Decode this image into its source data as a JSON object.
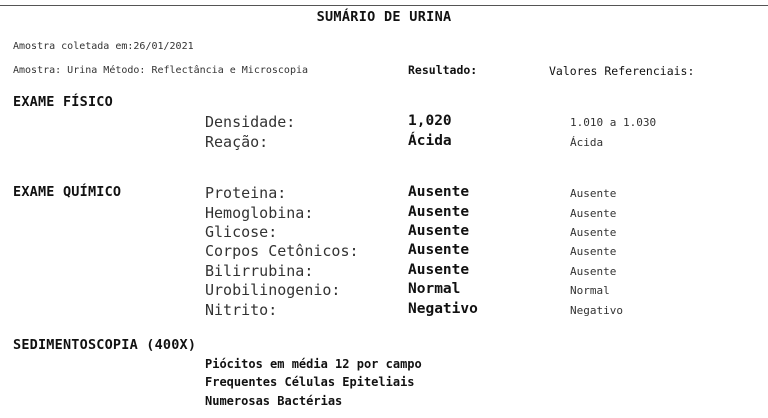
{
  "title": "SUMÁRIO DE URINA",
  "collected": "Amostra coletada em:26/01/2021",
  "sample_method": "Amostra: Urina  Método: Reflectância e Microscopia",
  "result_header": "Resultado:",
  "reference_header": "Valores Referenciais:",
  "physical": {
    "heading": "EXAME FÍSICO",
    "rows": [
      {
        "label": "Densidade:",
        "result": "1,020",
        "reference": "1.010 a 1.030"
      },
      {
        "label": "Reação:",
        "result": "Ácida",
        "reference": "Ácida"
      }
    ]
  },
  "chemical": {
    "heading": "EXAME QUÍMICO",
    "rows": [
      {
        "label": "Proteina:",
        "result": "Ausente",
        "reference": "Ausente"
      },
      {
        "label": "Hemoglobina:",
        "result": "Ausente",
        "reference": "Ausente"
      },
      {
        "label": "Glicose:",
        "result": "Ausente",
        "reference": "Ausente"
      },
      {
        "label": "Corpos Cetônicos:",
        "result": "Ausente",
        "reference": "Ausente"
      },
      {
        "label": "Bilirrubina:",
        "result": "Ausente",
        "reference": "Ausente"
      },
      {
        "label": "Urobilinogenio:",
        "result": "Normal",
        "reference": "Normal"
      },
      {
        "label": "Nitrito:",
        "result": "Negativo",
        "reference": "Negativo"
      }
    ]
  },
  "sediment": {
    "heading": "SEDIMENTOSCOPIA (400X)",
    "lines": [
      "Piócitos em média  12 por campo",
      "Frequentes Células Epiteliais",
      "Numerosas Bactérias"
    ]
  }
}
